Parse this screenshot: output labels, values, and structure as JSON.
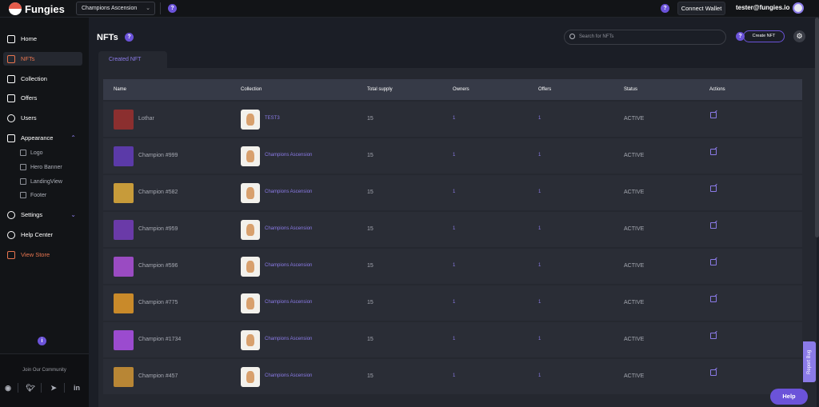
{
  "app": {
    "name": "Fungies"
  },
  "topbar": {
    "store_selector": "Champions Ascension",
    "connect_wallet": "Connect Wallet",
    "user_email": "tester@fungies.io"
  },
  "sidebar": {
    "items": [
      {
        "label": "Home",
        "icon": "home-icon"
      },
      {
        "label": "NFTs",
        "icon": "image-icon"
      },
      {
        "label": "Collection",
        "icon": "collection-icon"
      },
      {
        "label": "Offers",
        "icon": "offers-icon"
      },
      {
        "label": "Users",
        "icon": "user-icon"
      },
      {
        "label": "Appearance",
        "icon": "pencil-icon"
      },
      {
        "label": "Settings",
        "icon": "gear-icon"
      },
      {
        "label": "Help Center",
        "icon": "bulb-icon"
      },
      {
        "label": "View Store",
        "icon": "store-icon"
      }
    ],
    "appearance_sub": [
      "Logo",
      "Hero Banner",
      "LandingView",
      "Footer"
    ],
    "community_title": "Join Our Community",
    "social_icons": [
      "discord-icon",
      "twitter-icon",
      "telegram-icon",
      "linkedin-icon"
    ]
  },
  "page": {
    "title": "NFTs",
    "search_placeholder": "Search for NFTs",
    "create_button": "Create NFT",
    "tab": "Created NFT"
  },
  "table": {
    "columns": [
      "Name",
      "Collection",
      "Total supply",
      "Owners",
      "Offers",
      "Status",
      "Actions"
    ],
    "rows": [
      {
        "name": "Lothar",
        "collection": "TEST3",
        "supply": "15",
        "owners": "1",
        "offers": "1",
        "status": "ACTIVE"
      },
      {
        "name": "Champion #999",
        "collection": "Champions Ascension",
        "supply": "15",
        "owners": "1",
        "offers": "1",
        "status": "ACTIVE"
      },
      {
        "name": "Champion #582",
        "collection": "Champions Ascension",
        "supply": "15",
        "owners": "1",
        "offers": "1",
        "status": "ACTIVE"
      },
      {
        "name": "Champion #959",
        "collection": "Champions Ascension",
        "supply": "15",
        "owners": "1",
        "offers": "1",
        "status": "ACTIVE"
      },
      {
        "name": "Champion #596",
        "collection": "Champions Ascension",
        "supply": "15",
        "owners": "1",
        "offers": "1",
        "status": "ACTIVE"
      },
      {
        "name": "Champion #775",
        "collection": "Champions Ascension",
        "supply": "15",
        "owners": "1",
        "offers": "1",
        "status": "ACTIVE"
      },
      {
        "name": "Champion #1734",
        "collection": "Champions Ascension",
        "supply": "15",
        "owners": "1",
        "offers": "1",
        "status": "ACTIVE"
      },
      {
        "name": "Champion #457",
        "collection": "Champions Ascension",
        "supply": "15",
        "owners": "1",
        "offers": "1",
        "status": "ACTIVE"
      }
    ]
  },
  "floating": {
    "report_bug": "Report Bug",
    "help": "Help"
  },
  "colors": {
    "accent": "#6b53d9",
    "active_nav": "#e8754f",
    "link": "#8b7be8"
  }
}
